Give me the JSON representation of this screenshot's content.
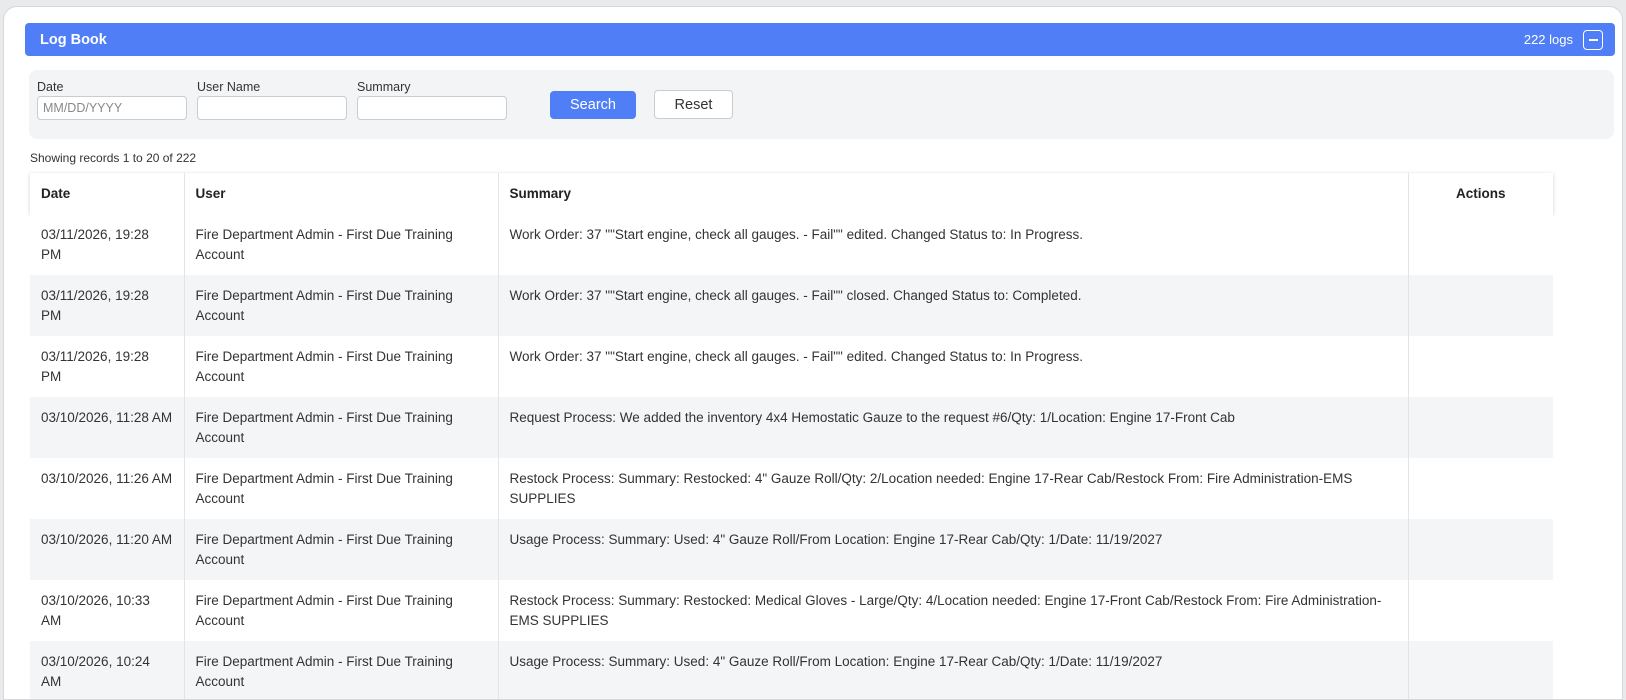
{
  "panel": {
    "title": "Log Book",
    "count_label": "222 logs"
  },
  "filters": {
    "date_label": "Date",
    "date_placeholder": "MM/DD/YYYY",
    "user_label": "User Name",
    "user_value": "",
    "summary_label": "Summary",
    "summary_value": "",
    "search_label": "Search",
    "reset_label": "Reset"
  },
  "records_info": "Showing records 1 to 20 of 222",
  "table": {
    "headers": [
      "Date",
      "User",
      "Summary",
      "Actions"
    ],
    "rows": [
      {
        "date": "03/11/2026, 19:28 PM",
        "user": "Fire Department Admin - First Due Training Account",
        "summary": "Work Order: 37 \"\"Start engine, check all gauges. - Fail\"\" edited. Changed Status to: In Progress.",
        "actions": ""
      },
      {
        "date": "03/11/2026, 19:28 PM",
        "user": "Fire Department Admin - First Due Training Account",
        "summary": "Work Order: 37 \"\"Start engine, check all gauges. - Fail\"\" closed. Changed Status to: Completed.",
        "actions": ""
      },
      {
        "date": "03/11/2026, 19:28 PM",
        "user": "Fire Department Admin - First Due Training Account",
        "summary": "Work Order: 37 \"\"Start engine, check all gauges. - Fail\"\" edited. Changed Status to: In Progress.",
        "actions": ""
      },
      {
        "date": "03/10/2026, 11:28 AM",
        "user": "Fire Department Admin - First Due Training Account",
        "summary": "Request Process: We added the inventory 4x4 Hemostatic Gauze to the request #6/Qty: 1/Location: Engine 17-Front Cab",
        "actions": ""
      },
      {
        "date": "03/10/2026, 11:26 AM",
        "user": "Fire Department Admin - First Due Training Account",
        "summary": "Restock Process: Summary: Restocked: 4\" Gauze Roll/Qty: 2/Location needed: Engine 17-Rear Cab/Restock From: Fire Administration-EMS SUPPLIES",
        "actions": ""
      },
      {
        "date": "03/10/2026, 11:20 AM",
        "user": "Fire Department Admin - First Due Training Account",
        "summary": "Usage Process: Summary: Used: 4\" Gauze Roll/From Location: Engine 17-Rear Cab/Qty: 1/Date: 11/19/2027",
        "actions": ""
      },
      {
        "date": "03/10/2026, 10:33 AM",
        "user": "Fire Department Admin - First Due Training Account",
        "summary": "Restock Process: Summary: Restocked: Medical Gloves - Large/Qty: 4/Location needed: Engine 17-Front Cab/Restock From: Fire Administration-EMS SUPPLIES",
        "actions": ""
      },
      {
        "date": "03/10/2026, 10:24 AM",
        "user": "Fire Department Admin - First Due Training Account",
        "summary": "Usage Process: Summary: Used: 4\" Gauze Roll/From Location: Engine 17-Rear Cab/Qty: 1/Date: 11/19/2027",
        "actions": ""
      }
    ]
  }
}
